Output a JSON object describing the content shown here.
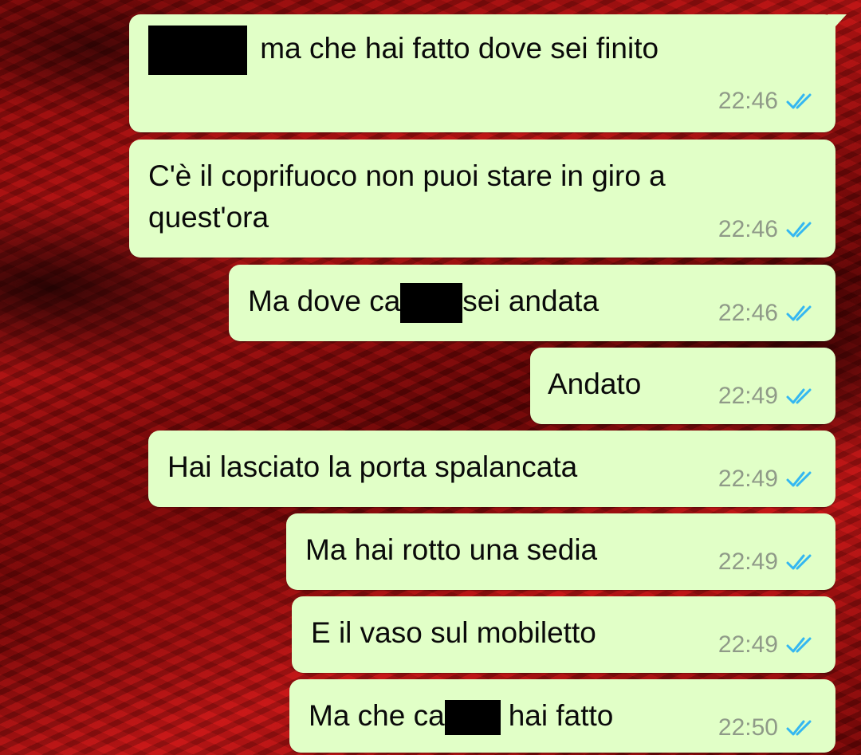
{
  "colors": {
    "bubble_bg": "#e1ffc7",
    "tick_color": "#34b7f1",
    "time_color": "#8f9a88"
  },
  "icons": {
    "read_receipt": "double-check-icon",
    "redaction": "redaction-bar"
  },
  "messages": [
    {
      "text_after": "ma che hai fatto dove sei finito",
      "time": "22:46",
      "status": "read"
    },
    {
      "line1": "C'è il coprifuoco non puoi stare in giro a",
      "line2": "quest'ora",
      "time": "22:46",
      "status": "read"
    },
    {
      "text_before": "Ma dove ca",
      "text_after": "sei andata",
      "time": "22:46",
      "status": "read"
    },
    {
      "text": "Andato",
      "time": "22:49",
      "status": "read"
    },
    {
      "text": "Hai lasciato la porta spalancata",
      "time": "22:49",
      "status": "read"
    },
    {
      "text": "Ma hai rotto una sedia",
      "time": "22:49",
      "status": "read"
    },
    {
      "text": "E il vaso sul mobiletto",
      "time": "22:49",
      "status": "read"
    },
    {
      "text_before": "Ma che ca",
      "text_after": "hai fatto",
      "time": "22:50",
      "status": "read"
    }
  ]
}
